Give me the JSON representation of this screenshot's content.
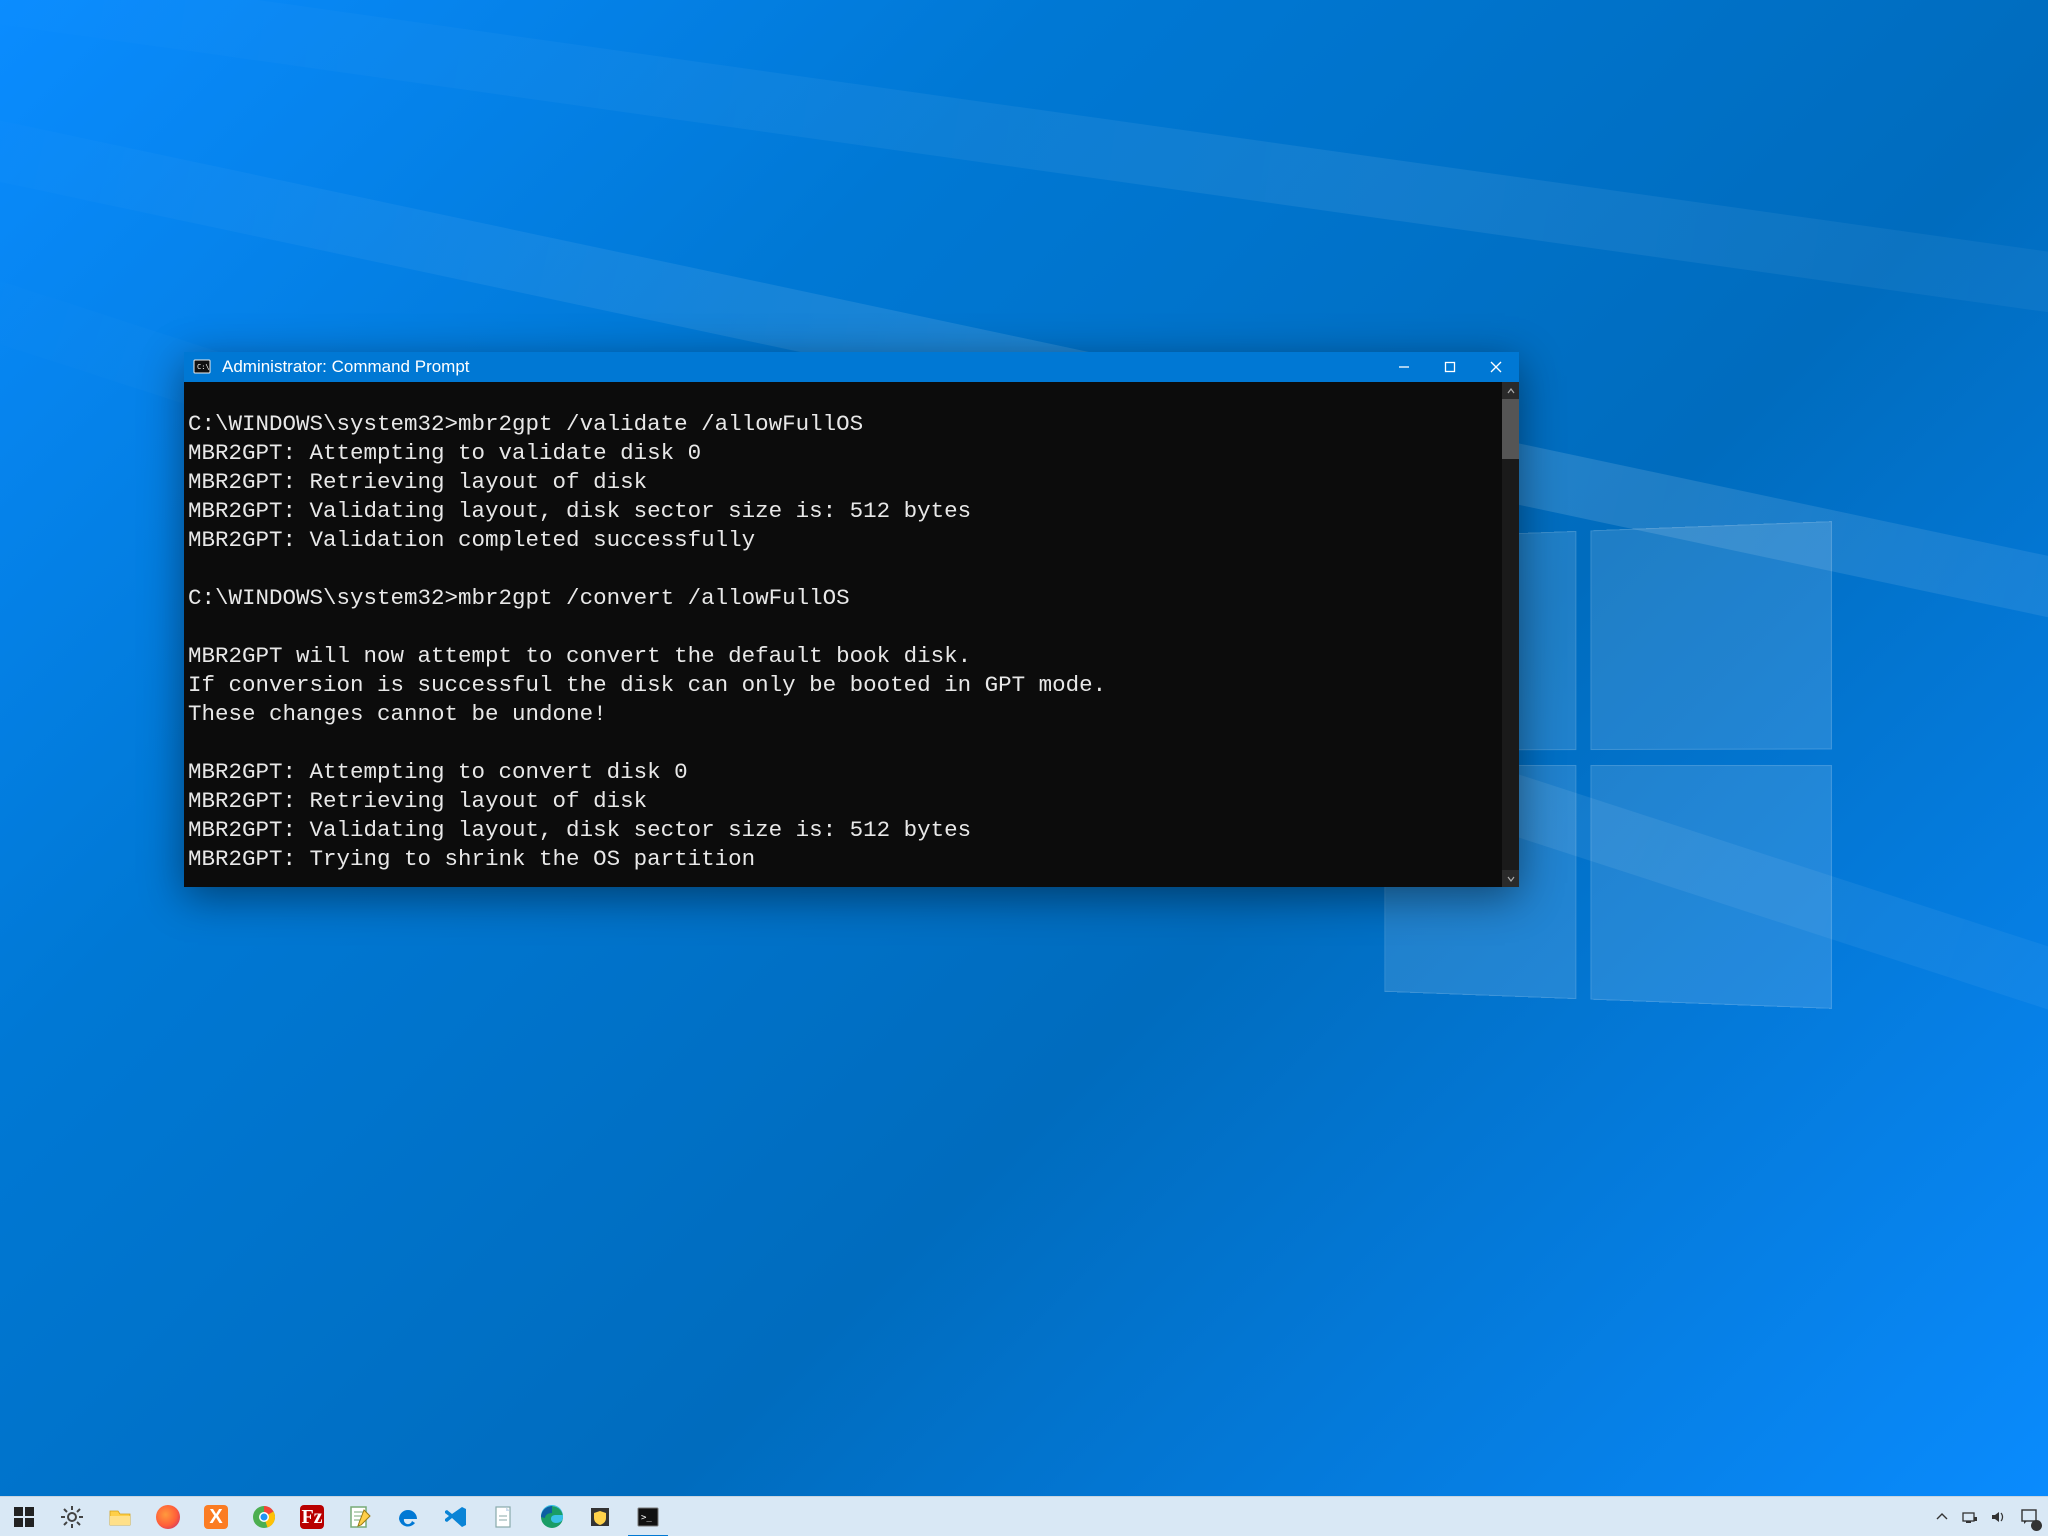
{
  "window": {
    "title": "Administrator: Command Prompt"
  },
  "terminal": {
    "lines": [
      "C:\\WINDOWS\\system32>mbr2gpt /validate /allowFullOS",
      "MBR2GPT: Attempting to validate disk 0",
      "MBR2GPT: Retrieving layout of disk",
      "MBR2GPT: Validating layout, disk sector size is: 512 bytes",
      "MBR2GPT: Validation completed successfully",
      "",
      "C:\\WINDOWS\\system32>mbr2gpt /convert /allowFullOS",
      "",
      "MBR2GPT will now attempt to convert the default book disk.",
      "If conversion is successful the disk can only be booted in GPT mode.",
      "These changes cannot be undone!",
      "",
      "MBR2GPT: Attempting to convert disk 0",
      "MBR2GPT: Retrieving layout of disk",
      "MBR2GPT: Validating layout, disk sector size is: 512 bytes",
      "MBR2GPT: Trying to shrink the OS partition"
    ]
  },
  "taskbar": {
    "items": [
      {
        "name": "start",
        "label": "Start"
      },
      {
        "name": "settings",
        "label": "Settings"
      },
      {
        "name": "file-explorer",
        "label": "File Explorer"
      },
      {
        "name": "firefox",
        "label": "Firefox"
      },
      {
        "name": "xampp",
        "label": "XAMPP"
      },
      {
        "name": "chrome",
        "label": "Google Chrome"
      },
      {
        "name": "filezilla",
        "label": "FileZilla"
      },
      {
        "name": "notepadpp",
        "label": "Notepad++"
      },
      {
        "name": "edge-legacy",
        "label": "Microsoft Edge"
      },
      {
        "name": "vscode",
        "label": "Visual Studio Code"
      },
      {
        "name": "explorer-doc",
        "label": "Document"
      },
      {
        "name": "edge",
        "label": "Microsoft Edge"
      },
      {
        "name": "security",
        "label": "Windows Security"
      },
      {
        "name": "cmd",
        "label": "Command Prompt",
        "active": true
      }
    ]
  },
  "tray": {
    "items": [
      {
        "name": "chevron-up",
        "label": "Show hidden icons"
      },
      {
        "name": "network",
        "label": "Network"
      },
      {
        "name": "volume",
        "label": "Volume"
      },
      {
        "name": "action-center",
        "label": "Action Center"
      }
    ]
  }
}
